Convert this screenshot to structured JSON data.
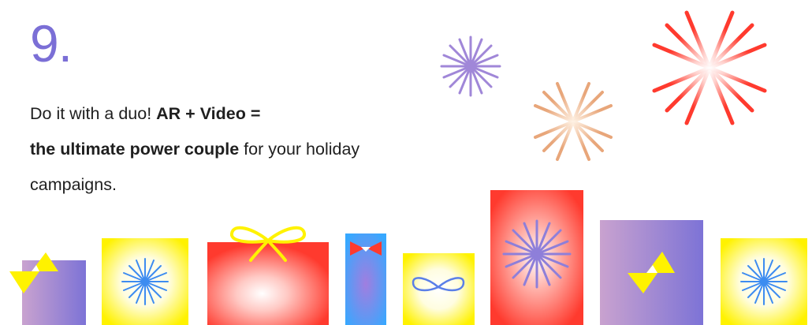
{
  "heading": {
    "number": "9."
  },
  "text": {
    "part1": "Do it with a duo! ",
    "bold1": "AR + Video =",
    "bold2": "the ultimate power couple",
    "part2": " for your holiday campaigns."
  },
  "colors": {
    "number": "#7b6fd6",
    "red": "#ff3a2e",
    "yellow": "#fff200",
    "purple": "#8e7fd9",
    "blue": "#3ea2ff",
    "peach": "#e8a67a",
    "lavender": "#a087d8"
  }
}
